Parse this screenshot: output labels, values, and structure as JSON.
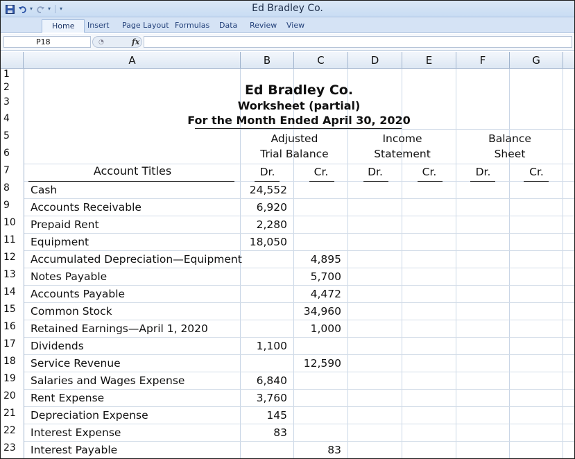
{
  "window": {
    "title": "Ed Bradley Co."
  },
  "ribbon": {
    "tabs": [
      "Home",
      "Insert",
      "Page Layout",
      "Formulas",
      "Data",
      "Review",
      "View"
    ],
    "active_tab": "Home"
  },
  "formula_bar": {
    "name_box": "P18",
    "fx_label": "fx",
    "formula": ""
  },
  "columns": [
    "A",
    "B",
    "C",
    "D",
    "E",
    "F",
    "G"
  ],
  "rows": [
    "1",
    "2",
    "3",
    "4",
    "5",
    "6",
    "7",
    "8",
    "9",
    "10",
    "11",
    "12",
    "13",
    "14",
    "15",
    "16",
    "17",
    "18",
    "19",
    "20",
    "21",
    "22",
    "23"
  ],
  "worksheet": {
    "company": "Ed Bradley Co.",
    "subtitle": "Worksheet (partial)",
    "period": "For the Month Ended April 30, 2020",
    "group_headers": {
      "atb_line1": "Adjusted",
      "atb_line2": "Trial Balance",
      "is_line1": "Income",
      "is_line2": "Statement",
      "bs_line1": "Balance",
      "bs_line2": "Sheet"
    },
    "account_titles_header": "Account Titles",
    "dr": "Dr.",
    "cr": "Cr.",
    "accounts": [
      {
        "title": "Cash",
        "dr": "24,552",
        "cr": ""
      },
      {
        "title": "Accounts Receivable",
        "dr": "6,920",
        "cr": ""
      },
      {
        "title": "Prepaid Rent",
        "dr": "2,280",
        "cr": ""
      },
      {
        "title": "Equipment",
        "dr": "18,050",
        "cr": ""
      },
      {
        "title": "Accumulated Depreciation—Equipment",
        "dr": "",
        "cr": "4,895"
      },
      {
        "title": "Notes Payable",
        "dr": "",
        "cr": "5,700"
      },
      {
        "title": "Accounts Payable",
        "dr": "",
        "cr": "4,472"
      },
      {
        "title": "Common Stock",
        "dr": "",
        "cr": "34,960"
      },
      {
        "title": "Retained Earnings—April 1, 2020",
        "dr": "",
        "cr": "1,000"
      },
      {
        "title": "Dividends",
        "dr": "1,100",
        "cr": ""
      },
      {
        "title": "Service Revenue",
        "dr": "",
        "cr": "12,590"
      },
      {
        "title": "Salaries and Wages Expense",
        "dr": "6,840",
        "cr": ""
      },
      {
        "title": "Rent Expense",
        "dr": "3,760",
        "cr": ""
      },
      {
        "title": "Depreciation Expense",
        "dr": "145",
        "cr": ""
      },
      {
        "title": "Interest Expense",
        "dr": "83",
        "cr": ""
      },
      {
        "title": "Interest Payable",
        "dr": "",
        "cr": "83"
      }
    ]
  }
}
